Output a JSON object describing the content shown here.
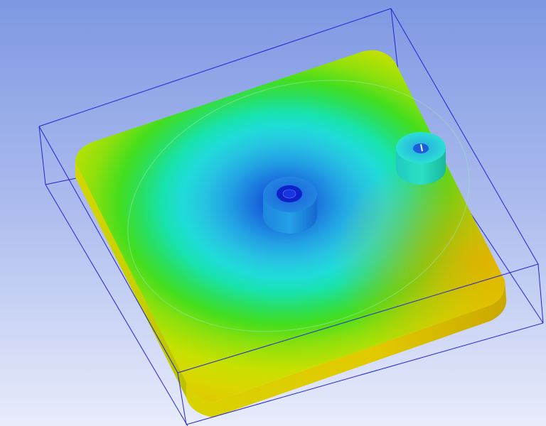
{
  "viewport": {
    "background_top": "#7d98e2",
    "background_bottom": "#e8ecfb",
    "bounding_box_color": "#2323d8"
  },
  "model": {
    "plate": {
      "contour_palette": [
        "#0a2fd0",
        "#1a8ae0",
        "#27b5e8",
        "#1fd8d8",
        "#16e3a2",
        "#33de3a",
        "#8ee00c",
        "#cfe000",
        "#dfd400",
        "#e7b400"
      ],
      "side_color_dark": "#b3b400",
      "side_color_light": "#e0de00"
    },
    "bosses": [
      {
        "id": "center-boss",
        "top_color": "#1e6fe0",
        "side_color": "#1a78d8",
        "hole_color": "#0d22c9"
      },
      {
        "id": "corner-boss",
        "top_color": "#24d3d8",
        "side_color": "#22d1b4",
        "hole_color": "#1c5ed8"
      }
    ]
  }
}
